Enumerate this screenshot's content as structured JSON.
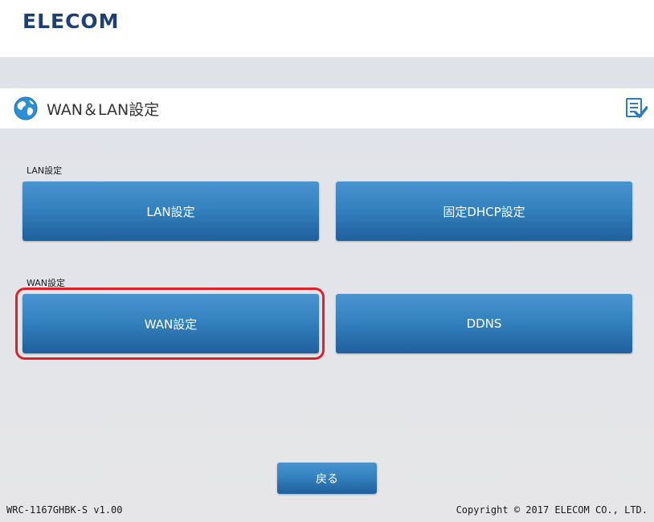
{
  "header": {
    "logo": "ELECOM"
  },
  "page": {
    "title": "WAN＆LAN設定"
  },
  "lan_section": {
    "label": "LAN設定",
    "buttons": [
      "LAN設定",
      "固定DHCP設定"
    ]
  },
  "wan_section": {
    "label": "WAN設定",
    "buttons": [
      "WAN設定",
      "DDNS"
    ]
  },
  "back_button": "戻る",
  "footer": {
    "model": "WRC-1167GHBK-S v1.00",
    "copyright": "Copyright © 2017 ELECOM CO., LTD."
  },
  "colors": {
    "brand": "#1d3f73",
    "button": "#2f7bbd",
    "highlight": "#e0202a"
  },
  "icons": [
    "globe-icon",
    "checklist-icon"
  ]
}
